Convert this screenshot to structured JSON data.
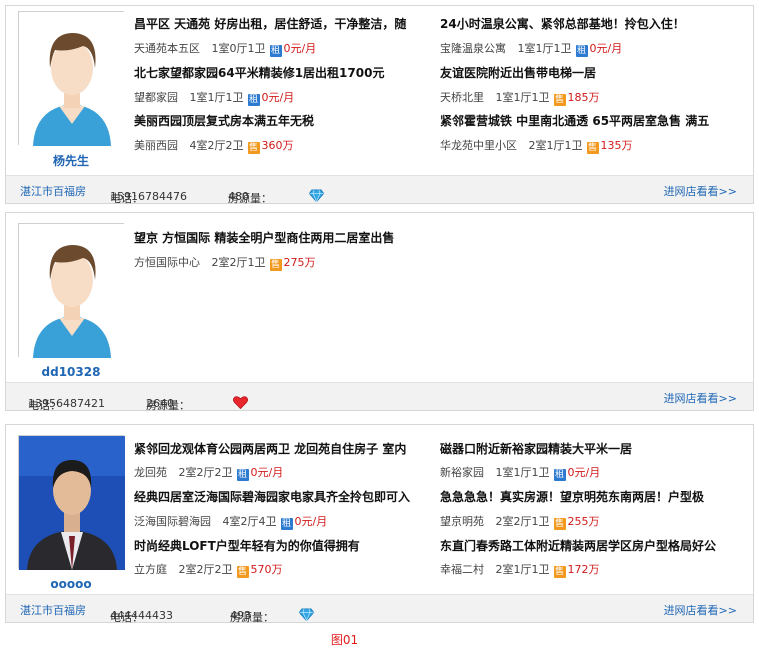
{
  "cards": [
    {
      "agent_name": "杨先生",
      "city": "湛江市百福房",
      "phone_label": "电话：",
      "phone": "15916784476",
      "listings_label": "房源量：",
      "listings": "480",
      "rating": {
        "type": "diamond",
        "count": 5
      },
      "more_label": "进网店看看>>",
      "photo": "default-avatar",
      "items": [
        {
          "title": "昌平区  天通苑  好房出租，居住舒适，干净整洁，随",
          "estate": "天通苑本五区",
          "layout": "1室0厅1卫",
          "deal": "租",
          "price": "0元/月"
        },
        {
          "title": "24小时温泉公寓、紧邻总部基地！拎包入住！",
          "estate": "宝隆温泉公寓",
          "layout": "1室1厅1卫",
          "deal": "租",
          "price": "0元/月"
        },
        {
          "title": "北七家望都家园64平米精装修1居出租1700元",
          "estate": "望都家园",
          "layout": "1室1厅1卫",
          "deal": "租",
          "price": "0元/月"
        },
        {
          "title": "友谊医院附近出售带电梯一居",
          "estate": "天桥北里",
          "layout": "1室1厅1卫",
          "deal": "售",
          "price": "185万"
        },
        {
          "title": "美丽西园顶层复式房本满五年无税",
          "estate": "美丽西园",
          "layout": "4室2厅2卫",
          "deal": "售",
          "price": "360万"
        },
        {
          "title": "紧邻霍营城铁  中里南北通透  65平两居室急售  满五",
          "estate": "华龙苑中里小区",
          "layout": "2室1厅1卫",
          "deal": "售",
          "price": "135万"
        }
      ]
    },
    {
      "agent_name": "dd10328",
      "city": "",
      "phone_label": "电话：",
      "phone": "13956487421",
      "listings_label": "房源量：",
      "listings": "2640",
      "rating": {
        "type": "heart",
        "count": 2
      },
      "more_label": "进网店看看>>",
      "photo": "default-avatar",
      "items": [
        {
          "title": "望京  方恒国际  精装全明户型商住两用二居室出售",
          "estate": "方恒国际中心",
          "layout": "2室2厅1卫",
          "deal": "售",
          "price": "275万"
        }
      ]
    },
    {
      "agent_name": "ooooo",
      "city": "湛江市百福房",
      "phone_label": "电话：",
      "phone": "444444433",
      "listings_label": "房源量：",
      "listings": "493",
      "rating": {
        "type": "diamond",
        "count": 5
      },
      "more_label": "进网店看看>>",
      "photo": "man-photo",
      "items": [
        {
          "title": "紧邻回龙观体育公园两居两卫  龙回苑自住房子  室内",
          "estate": "龙回苑",
          "layout": "2室2厅2卫",
          "deal": "租",
          "price": "0元/月"
        },
        {
          "title": "磁器口附近新裕家园精装大平米一居",
          "estate": "新裕家园",
          "layout": "1室1厅1卫",
          "deal": "租",
          "price": "0元/月"
        },
        {
          "title": "经典四居室泛海国际碧海园家电家具齐全拎包即可入",
          "estate": "泛海国际碧海园",
          "layout": "4室2厅4卫",
          "deal": "租",
          "price": "0元/月"
        },
        {
          "title": "急急急急！真实房源！望京明苑东南两居！户型极",
          "estate": "望京明苑",
          "layout": "2室2厅1卫",
          "deal": "售",
          "price": "255万"
        },
        {
          "title": "时尚经典LOFT户型年轻有为的你值得拥有",
          "estate": "立方庭",
          "layout": "2室2厅2卫",
          "deal": "售",
          "price": "570万"
        },
        {
          "title": "东直门春秀路工体附近精装两居学区房户型格局好公",
          "estate": "幸福二村",
          "layout": "2室1厅1卫",
          "deal": "售",
          "price": "172万"
        }
      ]
    }
  ],
  "caption": "图01",
  "colors": {
    "link": "#1f66b4",
    "price": "#d21a1a",
    "rent_tag": "#2d7ad1",
    "sell_tag": "#f29a1f",
    "caption": "#e21a1a"
  }
}
